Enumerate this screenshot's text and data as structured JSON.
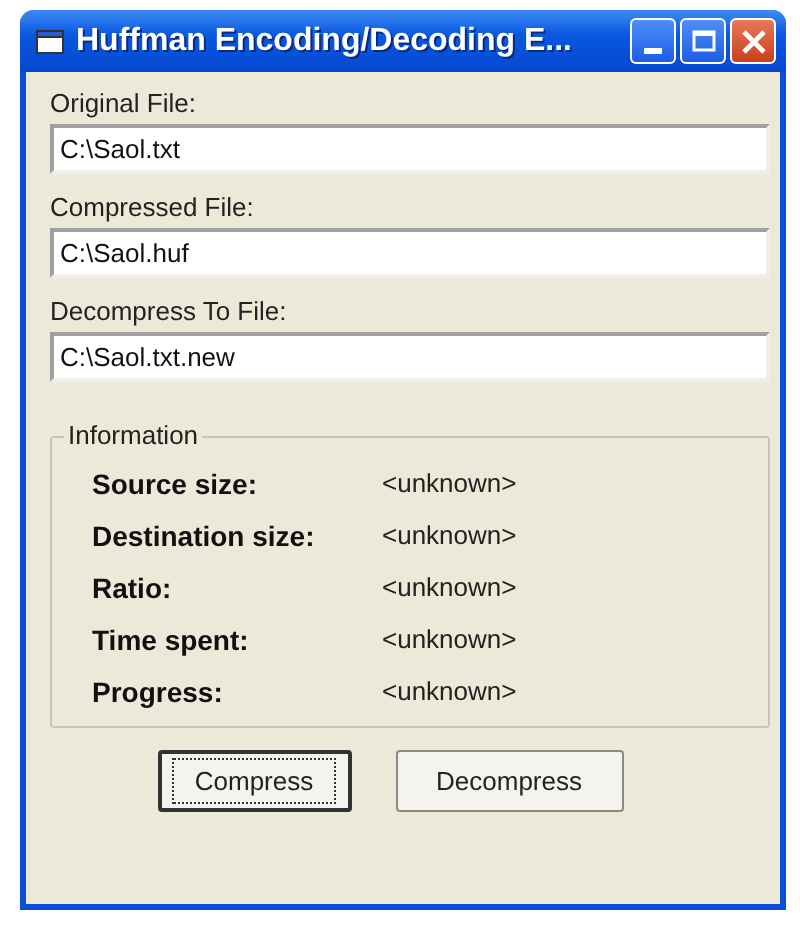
{
  "window": {
    "title": "Huffman Encoding/Decoding E..."
  },
  "fields": [
    {
      "label": "Original File:",
      "value": "C:\\Saol.txt"
    },
    {
      "label": "Compressed File:",
      "value": "C:\\Saol.huf"
    },
    {
      "label": "Decompress To File:",
      "value": "C:\\Saol.txt.new"
    }
  ],
  "information": {
    "title": "Information",
    "rows": [
      {
        "label": "Source size:",
        "value": "<unknown>"
      },
      {
        "label": "Destination size:",
        "value": "<unknown>"
      },
      {
        "label": "Ratio:",
        "value": "<unknown>"
      },
      {
        "label": "Time spent:",
        "value": "<unknown>"
      },
      {
        "label": "Progress:",
        "value": "<unknown>"
      }
    ]
  },
  "buttons": [
    {
      "label": "Compress",
      "focused": true
    },
    {
      "label": "Decompress",
      "focused": false
    }
  ]
}
